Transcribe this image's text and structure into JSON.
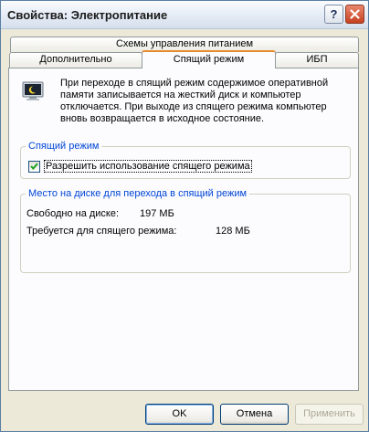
{
  "window": {
    "title": "Свойства: Электропитание",
    "help_label": "?",
    "close_icon": "close-icon"
  },
  "tabs": {
    "back_row": [
      {
        "label": "Схемы управления питанием"
      }
    ],
    "front_row": [
      {
        "label": "Дополнительно"
      },
      {
        "label": "Спящий режим",
        "active": true
      },
      {
        "label": "ИБП"
      }
    ]
  },
  "hibernate": {
    "icon": "power-monitor-icon",
    "description": "При переходе в спящий режим содержимое оперативной памяти записывается на жесткий диск и компьютер отключается. При выходе из спящего режима компьютер вновь возвращается в исходное состояние.",
    "mode_group": {
      "legend": "Спящий режим",
      "checkbox_label": "Разрешить использование спящего режима",
      "checked": true
    },
    "disk_group": {
      "legend": "Место на диске для перехода в спящий режим",
      "free_label": "Свободно на диске:",
      "free_value": "197 МБ",
      "required_label": "Требуется для спящего режима:",
      "required_value": "128 МБ"
    }
  },
  "buttons": {
    "ok": "OK",
    "cancel": "Отмена",
    "apply": "Применить"
  },
  "colors": {
    "accent_tab": "#e68b2c",
    "group_legend": "#0046d5",
    "close_button": "#c6401f"
  }
}
